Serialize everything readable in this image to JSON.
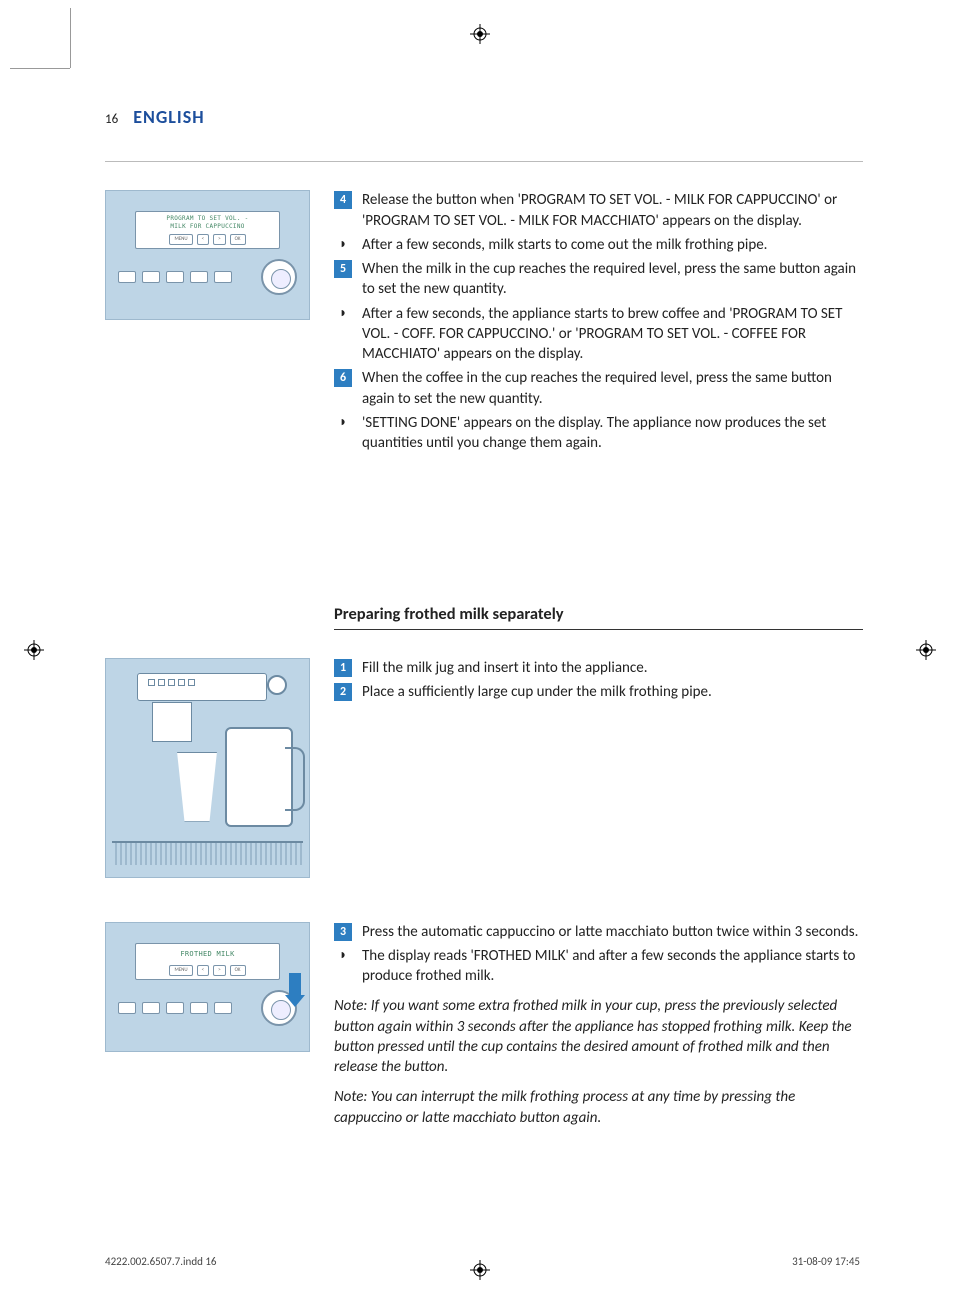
{
  "header": {
    "page_number": "16",
    "language": "ENGLISH"
  },
  "lcd1": {
    "line1": "PROGRAM TO SET VOL. -",
    "line2": "MILK FOR CAPPUCCINO"
  },
  "lcd2": {
    "line1": "FROTHED MILK"
  },
  "btns": {
    "menu": "MENU",
    "left": "<",
    "right": ">",
    "ok": "OK"
  },
  "steps_a": {
    "s4": "Release the button when 'PROGRAM TO SET VOL. - MILK FOR CAPPUCCINO' or 'PROGRAM TO SET VOL. - MILK FOR MACCHIATO' appears on the display.",
    "s4_sub": "After a few seconds, milk starts to come out the milk frothing pipe.",
    "s5": "When the milk in the cup reaches the required level, press the same button again to set the new quantity.",
    "s5_sub": "After a few seconds, the appliance starts to brew coffee and 'PROGRAM TO SET VOL. - COFF. FOR CAPPUCCINO.' or 'PROGRAM TO SET VOL. - COFFEE FOR MACCHIATO' appears on the display.",
    "s6": "When the coffee in the cup reaches the required level, press the same button again to set the new quantity.",
    "s6_sub": "'SETTING DONE' appears on the display. The appliance now produces the set quantities until you change them again."
  },
  "section2": {
    "title": "Preparing frothed milk separately",
    "s1": "Fill the milk jug and insert it into the appliance.",
    "s2": "Place a sufficiently large cup under the milk frothing pipe.",
    "s3": "Press the automatic cappuccino or latte macchiato button twice within 3 seconds.",
    "s3_sub": "The display reads 'FROTHED MILK' and after a few seconds the appliance starts to produce frothed milk.",
    "note1": "Note: If you want some extra frothed milk in your cup, press the previously selected button again within 3 seconds after the appliance has stopped frothing milk. Keep the button pressed until the cup contains the desired amount of frothed milk and then release the button.",
    "note2": "Note: You can interrupt the milk frothing process at any time by pressing the cappuccino or latte macchiato button again."
  },
  "footer": {
    "file": "4222.002.6507.7.indd   16",
    "date": "31-08-09   17:45"
  }
}
